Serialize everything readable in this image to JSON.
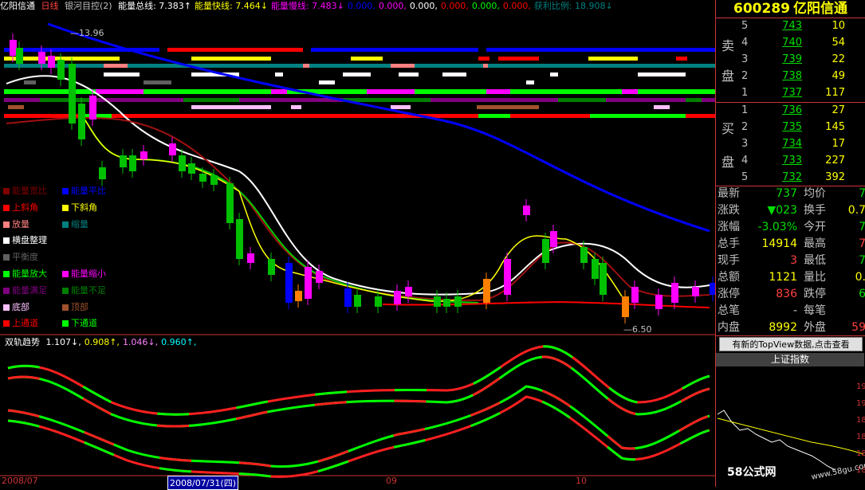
{
  "topbar": {
    "stock_name": "亿阳信通",
    "period": "日线",
    "indicator_name": "银河目控(2)",
    "metrics": [
      {
        "label": "能量总线:",
        "value": "7.383",
        "arrow": "↑",
        "color": "#ffffff"
      },
      {
        "label": "能量快线:",
        "value": "7.464",
        "arrow": "↓",
        "color": "#ffff00"
      },
      {
        "label": "能量慢线:",
        "value": "7.483",
        "arrow": "↓",
        "color": "#ff00ff"
      },
      {
        "label": "",
        "value": "0.000,",
        "arrow": "",
        "color": "#0000ff"
      },
      {
        "label": "",
        "value": "0.000,",
        "arrow": "",
        "color": "#ff00ff"
      },
      {
        "label": "",
        "value": "0.000,",
        "arrow": "",
        "color": "#ffffff"
      },
      {
        "label": "",
        "value": "0.000,",
        "arrow": "",
        "color": "#ff0000"
      },
      {
        "label": "",
        "value": "0.000,",
        "arrow": "",
        "color": "#00ff00"
      },
      {
        "label": "",
        "value": "0.000,",
        "arrow": "",
        "color": "#ff0000"
      },
      {
        "label": "获利比例:",
        "value": "18.908",
        "arrow": "↓",
        "color": "#008080"
      }
    ]
  },
  "legend": [
    {
      "label": "能量宽比",
      "color": "#800000",
      "col": 0,
      "row": 0
    },
    {
      "label": "能量平比",
      "color": "#0000ff",
      "col": 1,
      "row": 0
    },
    {
      "label": "上斜角",
      "color": "#ff0000",
      "col": 0,
      "row": 1
    },
    {
      "label": "下斜角",
      "color": "#ffff00",
      "col": 1,
      "row": 1
    },
    {
      "label": "放量",
      "color": "#ff8080",
      "col": 0,
      "row": 2
    },
    {
      "label": "缩量",
      "color": "#008080",
      "col": 1,
      "row": 2
    },
    {
      "label": "横盘整理",
      "color": "#ffffff",
      "col": 0,
      "row": 3
    },
    {
      "label": "平衡度",
      "color": "#606060",
      "col": 0,
      "row": 4
    },
    {
      "label": "能量放大",
      "color": "#00ff00",
      "col": 0,
      "row": 5
    },
    {
      "label": "能量缩小",
      "color": "#ff00ff",
      "col": 1,
      "row": 5
    },
    {
      "label": "能量满足",
      "color": "#800080",
      "col": 0,
      "row": 6
    },
    {
      "label": "能量不足",
      "color": "#008000",
      "col": 1,
      "row": 6
    },
    {
      "label": "底部",
      "color": "#ffc0ff",
      "col": 0,
      "row": 7
    },
    {
      "label": "顶部",
      "color": "#a0522d",
      "col": 1,
      "row": 7
    },
    {
      "label": "上通道",
      "color": "#ff0000",
      "col": 0,
      "row": 8
    },
    {
      "label": "下通道",
      "color": "#00ff00",
      "col": 1,
      "row": 8
    }
  ],
  "annotations": {
    "high_label": "13.96",
    "low_label": "6.50"
  },
  "sub_chart": {
    "title": "双轨趋势",
    "values": [
      {
        "value": "1.107",
        "arrow": "↓",
        "color": "#ffffff"
      },
      {
        "value": "0.908",
        "arrow": "↑",
        "color": "#ffff00"
      },
      {
        "value": "1.046",
        "arrow": "↓",
        "color": "#ff80ff"
      },
      {
        "value": "0.960",
        "arrow": "↑",
        "color": "#00ffff"
      }
    ]
  },
  "xaxis": [
    {
      "label": "2008/07",
      "highlight": false
    },
    {
      "label": "2008/07/31(四)",
      "highlight": true
    },
    {
      "label": "09",
      "highlight": false
    },
    {
      "label": "10",
      "highlight": false
    }
  ],
  "quote": {
    "code": "600289",
    "name": "亿阳信通",
    "sell_label": [
      "卖",
      "盘"
    ],
    "buy_label": [
      "买",
      "盘"
    ],
    "sell": [
      {
        "level": "5",
        "price": "743",
        "volume": "10"
      },
      {
        "level": "4",
        "price": "740",
        "volume": "54"
      },
      {
        "level": "3",
        "price": "739",
        "volume": "22"
      },
      {
        "level": "2",
        "price": "738",
        "volume": "49"
      },
      {
        "level": "1",
        "price": "737",
        "volume": "117"
      }
    ],
    "buy": [
      {
        "level": "1",
        "price": "736",
        "volume": "27"
      },
      {
        "level": "2",
        "price": "735",
        "volume": "145"
      },
      {
        "level": "3",
        "price": "734",
        "volume": "17"
      },
      {
        "level": "4",
        "price": "733",
        "volume": "227"
      },
      {
        "level": "5",
        "price": "732",
        "volume": "392"
      }
    ],
    "stats_left": [
      {
        "label": "最新",
        "value": "737",
        "color": "#00e000"
      },
      {
        "label": "涨跌",
        "value": "▼023",
        "color": "#00e000"
      },
      {
        "label": "涨幅",
        "value": "-3.03%",
        "color": "#00e000"
      },
      {
        "label": "总手",
        "value": "14914",
        "color": "#ffff00"
      },
      {
        "label": "现手",
        "value": "3",
        "color": "#ff4040"
      },
      {
        "label": "总额",
        "value": "1121",
        "color": "#ffff00"
      },
      {
        "label": "涨停",
        "value": "836",
        "color": "#ff4040"
      },
      {
        "label": "总笔",
        "value": "-",
        "color": "#c0c0c0"
      },
      {
        "label": "内盘",
        "value": "8992",
        "color": "#ffff00"
      }
    ],
    "stats_right": [
      {
        "label": "均价",
        "value": "7",
        "color": "#00e000"
      },
      {
        "label": "换手",
        "value": "0.7",
        "color": "#ffff00"
      },
      {
        "label": "今开",
        "value": "7",
        "color": "#00e000"
      },
      {
        "label": "最高",
        "value": "7",
        "color": "#ff4040"
      },
      {
        "label": "最低",
        "value": "7",
        "color": "#00e000"
      },
      {
        "label": "量比",
        "value": "0.",
        "color": "#ffff00"
      },
      {
        "label": "跌停",
        "value": "6",
        "color": "#00e000"
      },
      {
        "label": "每笔",
        "value": "",
        "color": "#c0c0c0"
      },
      {
        "label": "外盘",
        "value": "59",
        "color": "#ff4040"
      }
    ],
    "topview_button": "有新的TopView数据,点击查看",
    "index_title": "上证指数",
    "index_axis": [
      "19",
      "19",
      "18",
      "18",
      "18",
      "18"
    ],
    "watermark": "58公式网",
    "watermark_url": "www.58gu.com"
  }
}
